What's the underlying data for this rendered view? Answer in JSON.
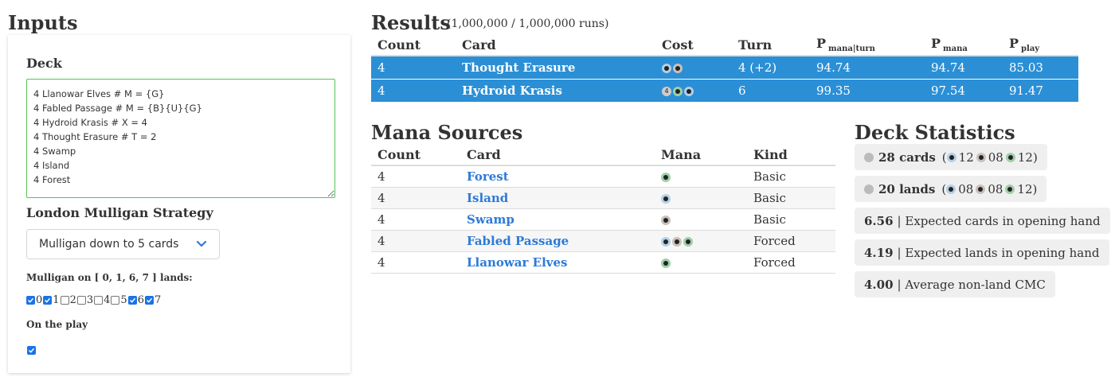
{
  "inputs": {
    "title": "Inputs",
    "deck_label": "Deck",
    "deck_text": "4 Llanowar Elves # M = {G}\n4 Fabled Passage # M = {B}{U}{G}\n4 Hydroid Krasis # X = 4\n4 Thought Erasure # T = 2\n4 Swamp\n4 Island\n4 Forest",
    "mulligan_label": "London Mulligan Strategy",
    "mulligan_value": "Mulligan down to 5 cards",
    "mulligan_lands_label": "Mulligan on [ 0, 1, 6, 7 ] lands:",
    "land_checkboxes": [
      {
        "label": "0",
        "checked": true
      },
      {
        "label": "1",
        "checked": true
      },
      {
        "label": "2",
        "checked": false
      },
      {
        "label": "3",
        "checked": false
      },
      {
        "label": "4",
        "checked": false
      },
      {
        "label": "5",
        "checked": false
      },
      {
        "label": "6",
        "checked": true
      },
      {
        "label": "7",
        "checked": true
      }
    ],
    "on_play_label": "On the play",
    "on_play_checked": true
  },
  "results": {
    "title": "Results",
    "subtitle": "(1,000,000 / 1,000,000 runs)",
    "headers": [
      "Count",
      "Card",
      "Cost",
      "Turn",
      "P",
      "P",
      "P"
    ],
    "header_subs": [
      "",
      "",
      "",
      "",
      "mana|turn",
      "mana",
      "play"
    ],
    "rows": [
      {
        "count": "4",
        "card": "Thought Erasure",
        "cost": [
          "U",
          "B"
        ],
        "turn": "4 (+2)",
        "p_mana_turn": "94.74",
        "p_mana": "94.74",
        "p_play": "85.03"
      },
      {
        "count": "4",
        "card": "Hydroid Krasis",
        "cost": [
          "4",
          "G",
          "U"
        ],
        "turn": "6",
        "p_mana_turn": "99.35",
        "p_mana": "97.54",
        "p_play": "91.47"
      }
    ]
  },
  "mana_sources": {
    "title": "Mana Sources",
    "headers": [
      "Count",
      "Card",
      "Mana",
      "Kind"
    ],
    "rows": [
      {
        "count": "4",
        "card": "Forest",
        "mana": [
          "G"
        ],
        "kind": "Basic"
      },
      {
        "count": "4",
        "card": "Island",
        "mana": [
          "U"
        ],
        "kind": "Basic"
      },
      {
        "count": "4",
        "card": "Swamp",
        "mana": [
          "B"
        ],
        "kind": "Basic"
      },
      {
        "count": "4",
        "card": "Fabled Passage",
        "mana": [
          "U",
          "B",
          "G"
        ],
        "kind": "Forced"
      },
      {
        "count": "4",
        "card": "Llanowar Elves",
        "mana": [
          "G"
        ],
        "kind": "Forced"
      }
    ]
  },
  "deck_stats": {
    "title": "Deck Statistics",
    "cards": {
      "label": "28 cards",
      "u": "12",
      "b": "08",
      "g": "12"
    },
    "lands": {
      "label": "20 lands",
      "u": "08",
      "b": "08",
      "g": "12"
    },
    "expected_cards": {
      "value": "6.56",
      "text": "| Expected cards in opening hand"
    },
    "expected_lands": {
      "value": "4.19",
      "text": "| Expected lands in opening hand"
    },
    "avg_cmc": {
      "value": "4.00",
      "text": "| Average non-land CMC"
    }
  }
}
